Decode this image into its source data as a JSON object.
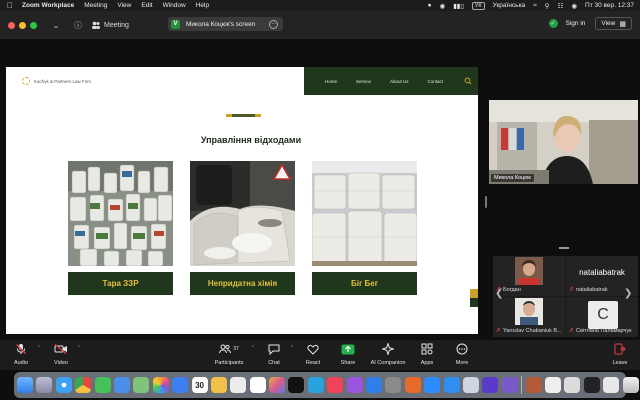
{
  "menubar": {
    "app": "Zoom Workplace",
    "items": [
      "Meeting",
      "View",
      "Edit",
      "Window",
      "Help"
    ],
    "keyboard": "УК",
    "keyboard_lang": "Українська",
    "datetime": "Пт 30 вер.  12:37"
  },
  "zoombar": {
    "meeting_label": "Meeting",
    "screen_badge": "V",
    "screen_title": "Микола Коцюк's screen",
    "sign_in": "Sign in",
    "view": "View"
  },
  "slide": {
    "logo_text": "Kachyk & Partners Law Firm",
    "nav": [
      "Home",
      "Service",
      "About Us",
      "Contact"
    ],
    "section_title": "Управління відходами",
    "cards": [
      {
        "caption": "Тара ЗЗР"
      },
      {
        "caption": "Непридатна хімія"
      },
      {
        "caption": "Біг Бег"
      }
    ]
  },
  "gallery": {
    "active_speaker": "Микола Коцюк",
    "participants": [
      {
        "name": "Богдан"
      },
      {
        "name": "nataliabatrak",
        "display": "nataliabatrak"
      },
      {
        "name": "Yaroslav Chabaniuk B..."
      },
      {
        "name": "Світлана Паламарчук",
        "initial": "С"
      }
    ]
  },
  "toolbar": {
    "audio": "Audio",
    "video": "Video",
    "participants": "Participants",
    "participants_count": "37",
    "chat": "Chat",
    "react": "React",
    "share": "Share",
    "ai_companion": "AI Companion",
    "apps": "Apps",
    "more": "More",
    "leave": "Leave"
  },
  "dock": {
    "calendar_day": "30"
  },
  "colors": {
    "nav_green": "#20361d",
    "caption_gold": "#e2c23a",
    "leave_red": "#e04040",
    "share_green": "#22b24c"
  }
}
